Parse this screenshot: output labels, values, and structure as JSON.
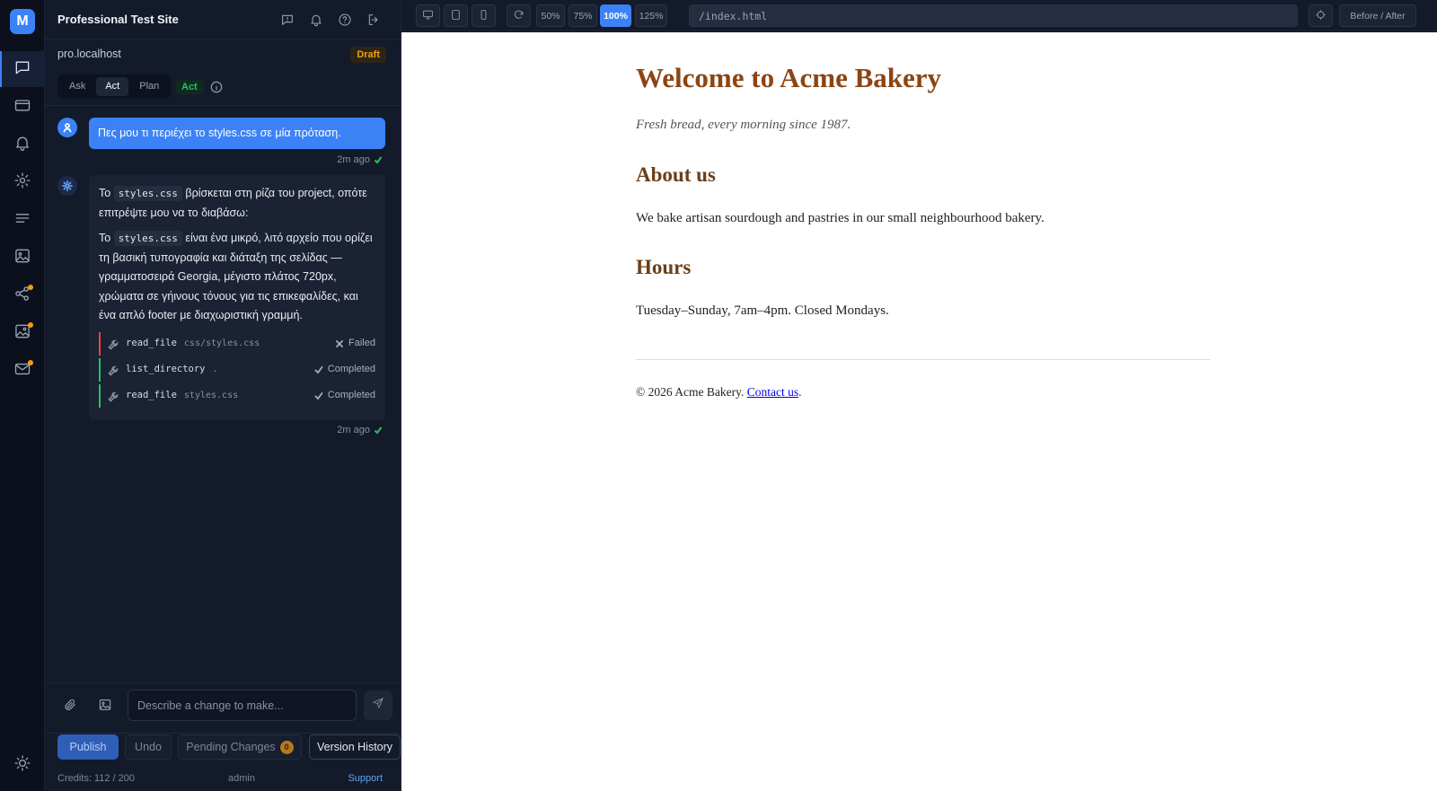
{
  "app": {
    "logo_letter": "M",
    "accent": "#3b82f6",
    "rail": [
      "chat-icon",
      "card-icon",
      "bell-icon",
      "gear-icon",
      "lines-icon",
      "image-icon",
      "share-icon",
      "image-edit-icon",
      "mail-icon",
      "sun-icon"
    ]
  },
  "panel": {
    "site_name": "Professional Test Site",
    "domain": "pro.localhost",
    "status_badge": "Draft",
    "modes": [
      "Ask",
      "Act",
      "Plan"
    ],
    "active_mode": "Act",
    "mode_badge": "Act"
  },
  "chat": {
    "user_message": "Πες μου τι περιέχει το styles.css σε μία πρόταση.",
    "user_time": "2m ago",
    "bot_p1_pre": "Το ",
    "bot_p1_code": "styles.css",
    "bot_p1_post": " βρίσκεται στη ρίζα του project, οπότε επιτρέψτε μου να το διαβάσω:",
    "bot_p2_pre": "Το ",
    "bot_p2_code": "styles.css",
    "bot_p2_post": " είναι ένα μικρό, λιτό αρχείο που ορίζει τη βασική τυπογραφία και διάταξη της σελίδας — γραμματοσειρά Georgia, μέγιστο πλάτος 720px, χρώματα σε γήινους τόνους για τις επικεφαλίδες, και ένα απλό footer με διαχωριστική γραμμή.",
    "tools": [
      {
        "name": "read_file",
        "arg": "css/styles.css",
        "status": "Failed"
      },
      {
        "name": "list_directory",
        "arg": ".",
        "status": "Completed"
      },
      {
        "name": "read_file",
        "arg": "styles.css",
        "status": "Completed"
      }
    ],
    "bot_time": "2m ago"
  },
  "composer": {
    "placeholder": "Describe a change to make..."
  },
  "actions": {
    "publish": "Publish",
    "undo": "Undo",
    "pending": "Pending Changes",
    "pending_count": "0",
    "version_history": "Version History"
  },
  "footer": {
    "credits": "Credits: 112 / 200",
    "user": "admin",
    "support": "Support"
  },
  "preview_toolbar": {
    "zooms": [
      "50%",
      "75%",
      "100%",
      "125%"
    ],
    "active_zoom": "100%",
    "url": "/index.html",
    "before_after": "Before / After"
  },
  "site": {
    "title": "Welcome to Acme Bakery",
    "tagline": "Fresh bread, every morning since 1987.",
    "about_heading": "About us",
    "about_text": "We bake artisan sourdough and pastries in our small neighbourhood bakery.",
    "hours_heading": "Hours",
    "hours_text": "Tuesday–Sunday, 7am–4pm. Closed Mondays.",
    "copyright": "© 2026 Acme Bakery. ",
    "contact_link": "Contact us",
    "copyright_end": ".",
    "heading_color": "#8b4513",
    "subheading_color": "#6b3f1a"
  }
}
